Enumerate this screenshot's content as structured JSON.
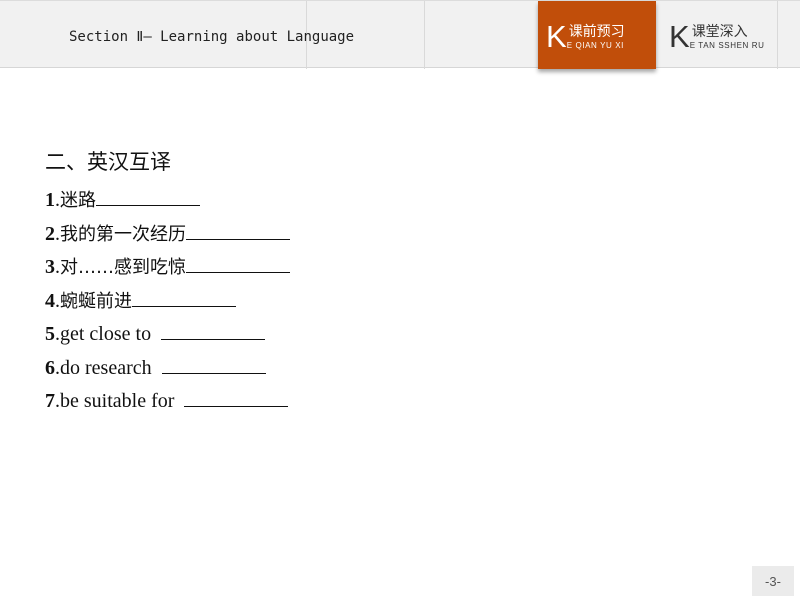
{
  "header": {
    "section_title": "Section Ⅱ— Learning about Language",
    "tabs": [
      {
        "k": "K",
        "label": "课前预习",
        "pinyin": "E QIAN YU XI",
        "active": true
      },
      {
        "k": "K",
        "label": "课堂深入",
        "pinyin": "E TAN SSHEN RU",
        "active": false
      }
    ],
    "accent_color": "#c14e0a"
  },
  "content": {
    "heading": "二、英汉互译",
    "items": [
      {
        "num": "1",
        "text": "迷路",
        "lang": "zh"
      },
      {
        "num": "2",
        "text": "我的第一次经历",
        "lang": "zh"
      },
      {
        "num": "3",
        "text": "对……感到吃惊",
        "lang": "zh"
      },
      {
        "num": "4",
        "text": "蜿蜒前进",
        "lang": "zh"
      },
      {
        "num": "5",
        "text": "get close to",
        "lang": "en"
      },
      {
        "num": "6",
        "text": "do research",
        "lang": "en"
      },
      {
        "num": "7",
        "text": "be suitable for",
        "lang": "en"
      }
    ]
  },
  "footer": {
    "page_number": "-3-"
  }
}
